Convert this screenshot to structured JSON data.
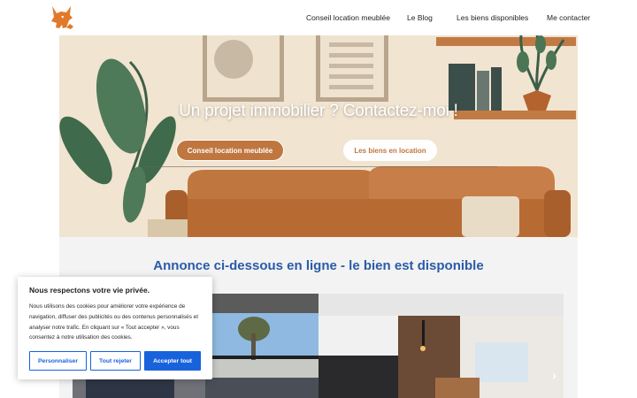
{
  "nav": {
    "items": [
      "Conseil location meublée",
      "Le Blog",
      "Les biens disponibles",
      "Me contacter"
    ]
  },
  "hero": {
    "title": "Un projet immobilier ? Contactez-moi !",
    "btn_primary": "Conseil location meublée",
    "btn_secondary": "Les biens en location"
  },
  "section": {
    "title": "Annonce ci-dessous en ligne - le bien est disponible"
  },
  "cookie": {
    "title": "Nous respectons votre vie privée.",
    "text": "Nous utilisons des cookies pour améliorer votre expérience de navigation, diffuser des publicités ou des contenus personnalisés et analyser notre trafic. En cliquant sur « Tout accepter », vous consentez à notre utilisation des cookies.",
    "customize": "Personnaliser",
    "reject": "Tout rejeter",
    "accept": "Accepter tout"
  },
  "colors": {
    "accent": "#c0763f",
    "title_blue": "#2a5ba8",
    "cookie_blue": "#1863dc"
  }
}
